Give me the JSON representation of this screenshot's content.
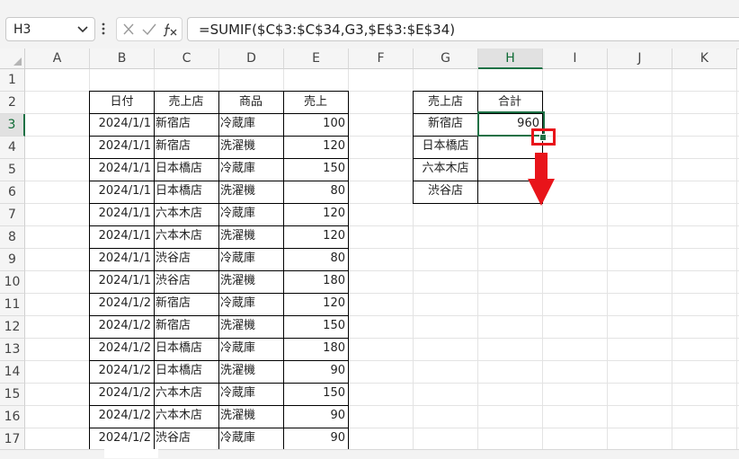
{
  "name_box": {
    "value": "H3"
  },
  "formula_bar": {
    "value": "=SUMIF($C$3:$C$34,G3,$E$3:$E$34)"
  },
  "columns": [
    "A",
    "B",
    "C",
    "D",
    "E",
    "F",
    "G",
    "H",
    "I",
    "J",
    "K"
  ],
  "rows": [
    "1",
    "2",
    "3",
    "4",
    "5",
    "6",
    "7",
    "8",
    "9",
    "10",
    "11",
    "12",
    "13",
    "14",
    "15",
    "16",
    "17"
  ],
  "table1": {
    "headers": [
      "日付",
      "売上店",
      "商品",
      "売上"
    ],
    "rows": [
      [
        "2024/1/1",
        "新宿店",
        "冷蔵庫",
        "100"
      ],
      [
        "2024/1/1",
        "新宿店",
        "洗濯機",
        "120"
      ],
      [
        "2024/1/1",
        "日本橋店",
        "冷蔵庫",
        "150"
      ],
      [
        "2024/1/1",
        "日本橋店",
        "洗濯機",
        "80"
      ],
      [
        "2024/1/1",
        "六本木店",
        "冷蔵庫",
        "120"
      ],
      [
        "2024/1/1",
        "六本木店",
        "洗濯機",
        "120"
      ],
      [
        "2024/1/1",
        "渋谷店",
        "冷蔵庫",
        "80"
      ],
      [
        "2024/1/1",
        "渋谷店",
        "洗濯機",
        "180"
      ],
      [
        "2024/1/2",
        "新宿店",
        "冷蔵庫",
        "120"
      ],
      [
        "2024/1/2",
        "新宿店",
        "洗濯機",
        "150"
      ],
      [
        "2024/1/2",
        "日本橋店",
        "冷蔵庫",
        "180"
      ],
      [
        "2024/1/2",
        "日本橋店",
        "洗濯機",
        "90"
      ],
      [
        "2024/1/2",
        "六本木店",
        "冷蔵庫",
        "150"
      ],
      [
        "2024/1/2",
        "六本木店",
        "洗濯機",
        "90"
      ],
      [
        "2024/1/2",
        "渋谷店",
        "冷蔵庫",
        "90"
      ]
    ]
  },
  "table2": {
    "headers": [
      "売上店",
      "合計"
    ],
    "rows": [
      [
        "新宿店",
        "960"
      ],
      [
        "日本橋店",
        ""
      ],
      [
        "六本木店",
        ""
      ],
      [
        "渋谷店",
        ""
      ]
    ]
  },
  "selection": {
    "active_cell": "H3",
    "accent": "#1e7145"
  },
  "annotation": {
    "color": "#e8141a"
  },
  "icons": [
    "chevron-down-icon",
    "more-vertical-icon",
    "cancel-icon",
    "confirm-check-icon",
    "insert-function-icon",
    "select-all-icon",
    "arrow-down-icon"
  ]
}
